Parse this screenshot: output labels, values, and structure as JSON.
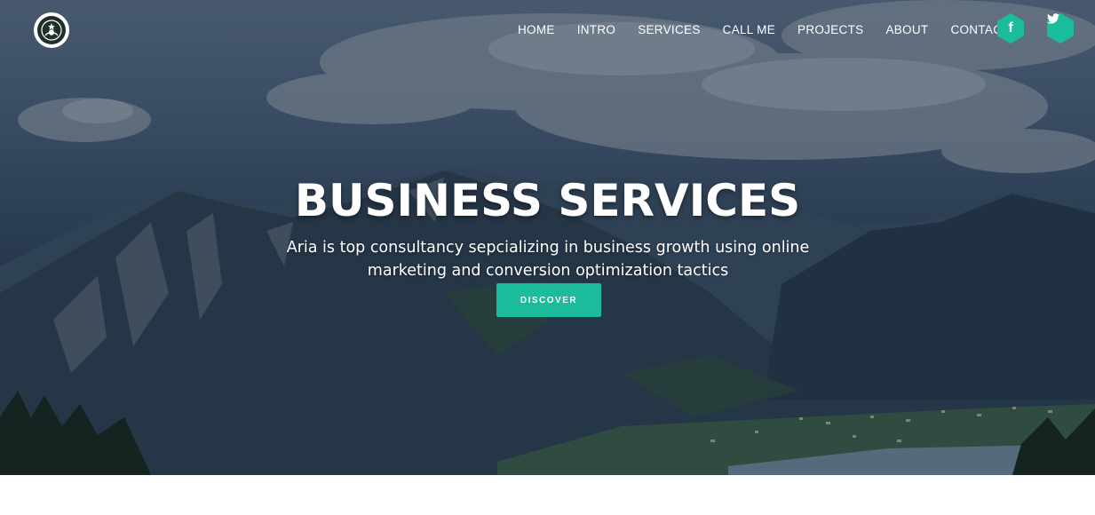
{
  "brand": {
    "logo_icon": "starbucks-siren-logo"
  },
  "nav": {
    "items": [
      {
        "label": "HOME"
      },
      {
        "label": "INTRO"
      },
      {
        "label": "SERVICES"
      },
      {
        "label": "CALL ME"
      },
      {
        "label": "PROJECTS"
      },
      {
        "label": "ABOUT"
      },
      {
        "label": "CONTACT"
      }
    ]
  },
  "social": {
    "facebook": {
      "icon": "facebook-icon",
      "glyph": "f"
    },
    "twitter": {
      "icon": "twitter-icon"
    },
    "color": "#1abc9c"
  },
  "hero": {
    "title": "BUSINESS SERVICES",
    "subtitle": "Aria is top consultancy sepcializing in business growth using online marketing and conversion optimization tactics",
    "cta_label": "DISCOVER",
    "background": "mountain-landscape-image"
  },
  "colors": {
    "accent": "#1abc9c",
    "text": "#ffffff"
  }
}
